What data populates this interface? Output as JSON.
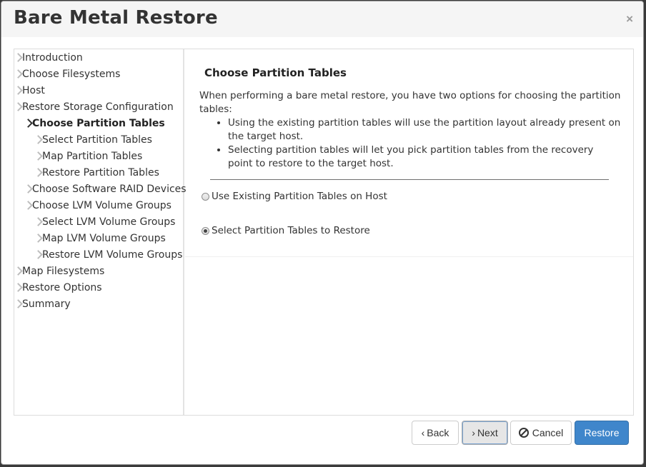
{
  "dialog": {
    "title": "Bare Metal Restore",
    "close_label": "×"
  },
  "nav": [
    {
      "label": "Introduction",
      "level": 0,
      "active": false
    },
    {
      "label": "Choose Filesystems",
      "level": 0,
      "active": false
    },
    {
      "label": "Host",
      "level": 0,
      "active": false
    },
    {
      "label": "Restore Storage Configuration",
      "level": 0,
      "active": false
    },
    {
      "label": "Choose Partition Tables",
      "level": 1,
      "active": true
    },
    {
      "label": "Select Partition Tables",
      "level": 2,
      "active": false
    },
    {
      "label": "Map Partition Tables",
      "level": 2,
      "active": false
    },
    {
      "label": "Restore Partition Tables",
      "level": 2,
      "active": false
    },
    {
      "label": "Choose Software RAID Devices",
      "level": 1,
      "active": false
    },
    {
      "label": "Choose LVM Volume Groups",
      "level": 1,
      "active": false
    },
    {
      "label": "Select LVM Volume Groups",
      "level": 2,
      "active": false
    },
    {
      "label": "Map LVM Volume Groups",
      "level": 2,
      "active": false
    },
    {
      "label": "Restore LVM Volume Groups",
      "level": 2,
      "active": false
    },
    {
      "label": "Map Filesystems",
      "level": 0,
      "active": false
    },
    {
      "label": "Restore Options",
      "level": 0,
      "active": false
    },
    {
      "label": "Summary",
      "level": 0,
      "active": false
    }
  ],
  "content": {
    "heading": "Choose Partition Tables",
    "intro": "When performing a bare metal restore, you have two options for choosing the partition tables:",
    "bullets": [
      "Using the existing partition tables will use the partition layout already present on the target host.",
      "Selecting partition tables will let you pick partition tables from the recovery point to restore to the target host."
    ],
    "options": [
      {
        "label": "Use Existing Partition Tables on Host",
        "checked": false
      },
      {
        "label": "Select Partition Tables to Restore",
        "checked": true
      }
    ]
  },
  "footer": {
    "back_label": "Back",
    "next_label": "Next",
    "cancel_label": "Cancel",
    "restore_label": "Restore",
    "back_icon": "chevron-left-icon",
    "next_icon": "chevron-right-icon",
    "cancel_icon": "ban-icon",
    "primary_color": "#3f86cb"
  }
}
